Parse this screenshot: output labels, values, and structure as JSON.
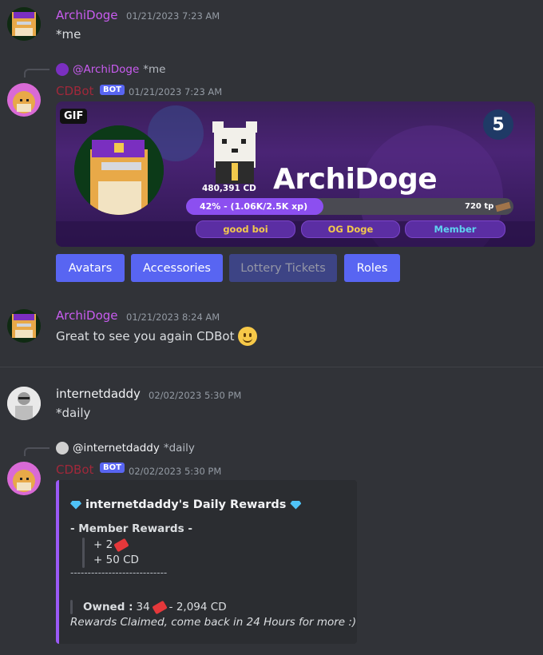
{
  "messages": {
    "m1": {
      "author": "ArchiDoge",
      "timestamp": "01/21/2023 7:23 AM",
      "text": "*me"
    },
    "m2": {
      "reply": {
        "author": "@ArchiDoge",
        "text": "*me"
      },
      "author": "CDBot",
      "badge": "BOT",
      "timestamp": "01/21/2023 7:23 AM",
      "card": {
        "gif_badge": "GIF",
        "level": "5",
        "username": "ArchiDoge",
        "balance": "480,391 CD",
        "progress_text": "42% - (1.06K/2.5K xp)",
        "progress": 0.42,
        "tp": "720 tp",
        "roles": [
          "good boi",
          "OG Doge",
          "Member"
        ]
      },
      "buttons": [
        "Avatars",
        "Accessories",
        "Lottery Tickets",
        "Roles"
      ]
    },
    "m3": {
      "author": "ArchiDoge",
      "timestamp": "01/21/2023 8:24 AM",
      "text": "Great to see you again CDBot"
    },
    "m4": {
      "author": "internetdaddy",
      "timestamp": "02/02/2023 5:30 PM",
      "text": "*daily"
    },
    "m5": {
      "reply": {
        "author": "@internetdaddy",
        "text": "*daily"
      },
      "author": "CDBot",
      "badge": "BOT",
      "timestamp": "02/02/2023 5:30 PM",
      "embed": {
        "title": "internetdaddy's Daily Rewards",
        "section_title": "- Member Rewards -",
        "reward1": "+ 2",
        "reward2": "+ 50 CD",
        "divider": "----------------------------",
        "owned_label": "Owned :",
        "owned_tickets": "34",
        "owned_cd": "- 2,094 CD",
        "footer": "Rewards Claimed, come back in 24 Hours for more :)"
      }
    }
  },
  "colors": {
    "archidoge": "#c95cf0",
    "cdbot": "#a0283a",
    "internetdaddy": "#f2f3f5",
    "blurple": "#5865f2",
    "embed_accent": "#9b59f6"
  }
}
